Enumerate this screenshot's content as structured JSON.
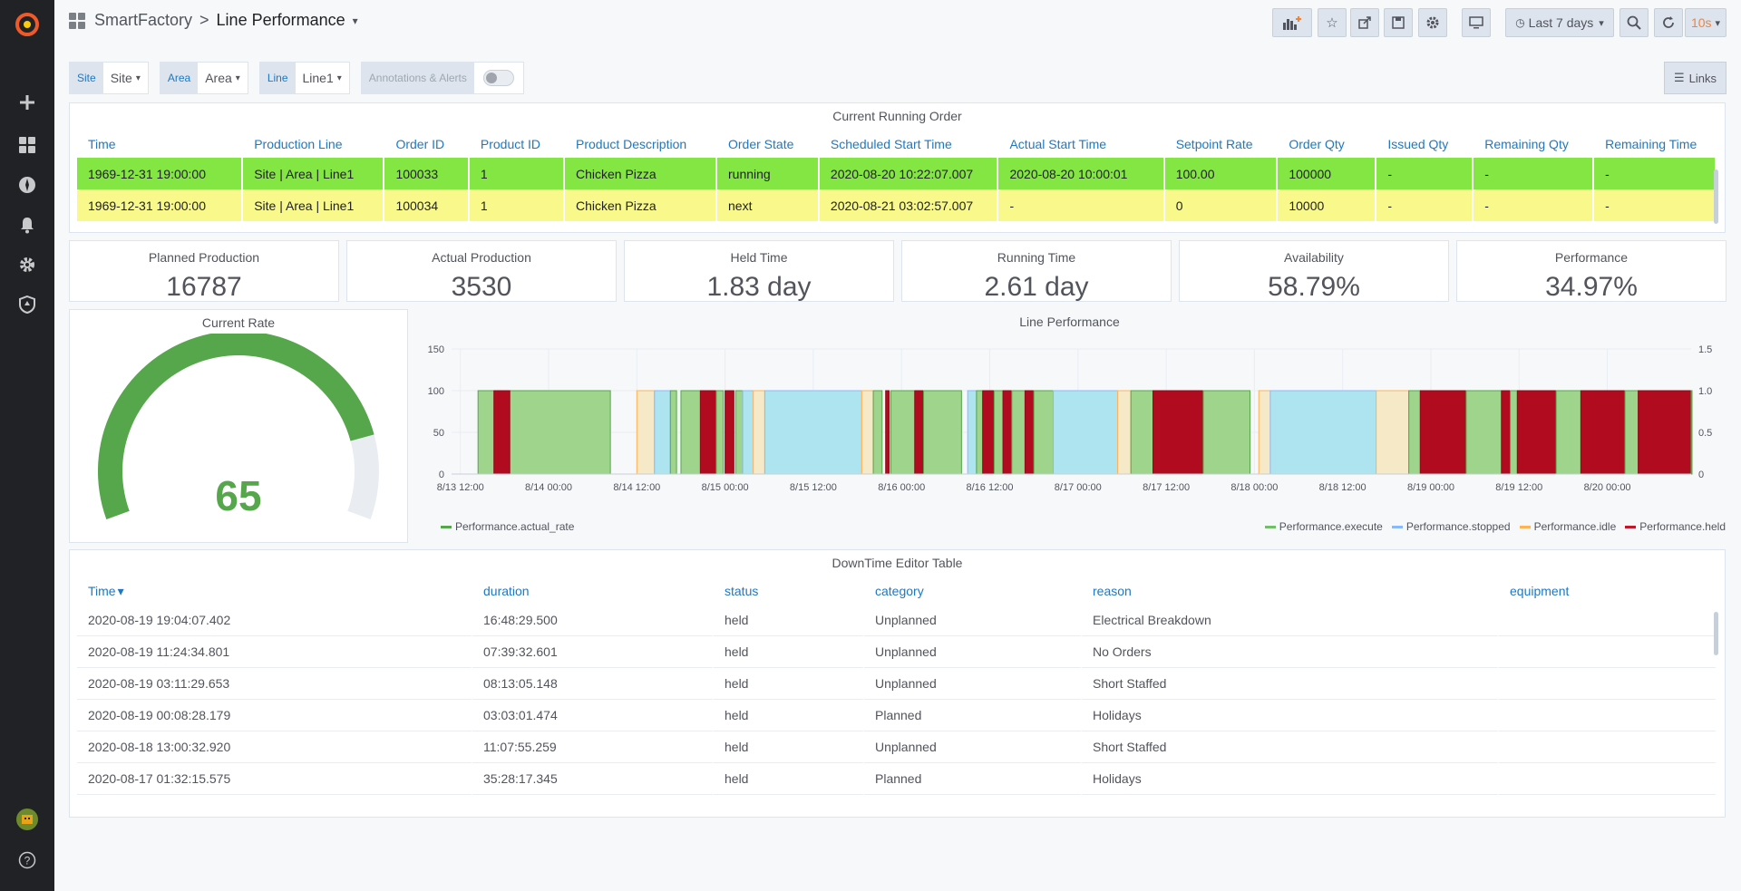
{
  "breadcrumb": {
    "folder": "SmartFactory",
    "separator": ">",
    "title": "Line Performance"
  },
  "toolbar": {
    "time_range": "Last 7 days",
    "refresh": "10s"
  },
  "variables": [
    {
      "label": "Site",
      "value": "Site"
    },
    {
      "label": "Area",
      "value": "Area"
    },
    {
      "label": "Line",
      "value": "Line1"
    }
  ],
  "annotations_label": "Annotations & Alerts",
  "links_label": "Links",
  "order_table": {
    "title": "Current Running Order",
    "headers": [
      "Time",
      "Production Line",
      "Order ID",
      "Product ID",
      "Product Description",
      "Order State",
      "Scheduled Start Time",
      "Actual Start Time",
      "Setpoint Rate",
      "Order Qty",
      "Issued Qty",
      "Remaining Qty",
      "Remaining Time"
    ],
    "rows": [
      [
        "1969-12-31 19:00:00",
        "Site | Area | Line1",
        "100033",
        "1",
        "Chicken Pizza",
        "running",
        "2020-08-20 10:22:07.007",
        "2020-08-20 10:00:01",
        "100.00",
        "100000",
        "-",
        "-",
        "-"
      ],
      [
        "1969-12-31 19:00:00",
        "Site | Area | Line1",
        "100034",
        "1",
        "Chicken Pizza",
        "next",
        "2020-08-21 03:02:57.007",
        "-",
        "0",
        "10000",
        "-",
        "-",
        "-"
      ]
    ],
    "row_colors": [
      "#84e643",
      "#f9f88a"
    ]
  },
  "stats": [
    {
      "label": "Planned Production",
      "value": "16787"
    },
    {
      "label": "Actual Production",
      "value": "3530"
    },
    {
      "label": "Held Time",
      "value": "1.83 day"
    },
    {
      "label": "Running Time",
      "value": "2.61 day"
    },
    {
      "label": "Availability",
      "value": "58.79%"
    },
    {
      "label": "Performance",
      "value": "34.97%"
    }
  ],
  "gauge": {
    "title": "Current Rate",
    "value": "65",
    "color": "#56a64b"
  },
  "chart_data": {
    "type": "area",
    "title": "Line Performance",
    "x_ticks": [
      "8/13 12:00",
      "8/14 00:00",
      "8/14 12:00",
      "8/15 00:00",
      "8/15 12:00",
      "8/16 00:00",
      "8/16 12:00",
      "8/17 00:00",
      "8/17 12:00",
      "8/18 00:00",
      "8/18 12:00",
      "8/19 00:00",
      "8/19 12:00",
      "8/20 00:00"
    ],
    "y_left": {
      "ticks": [
        "0",
        "50",
        "100",
        "150"
      ],
      "ylim": [
        0,
        150
      ]
    },
    "y_right": {
      "ticks": [
        "0",
        "0.5",
        "1.0",
        "1.5"
      ],
      "ylim": [
        0,
        1.5
      ]
    },
    "x_range": [
      -0.1,
      13.95
    ],
    "series_colors": {
      "execute": "#9ed48c",
      "stopped": "#aee3f0",
      "idle": "#f5e9c8",
      "held": "#b00b1e"
    },
    "legend_left": [
      {
        "name": "Performance.actual_rate",
        "color": "#56a64b"
      }
    ],
    "legend_right": [
      {
        "name": "Performance.execute",
        "color": "#73bf69"
      },
      {
        "name": "Performance.stopped",
        "color": "#8ab8ff"
      },
      {
        "name": "Performance.idle",
        "color": "#ffb357"
      },
      {
        "name": "Performance.held",
        "color": "#c4162a"
      }
    ],
    "segments": [
      {
        "s": "execute",
        "x0": 0.2,
        "x1": 1.7
      },
      {
        "s": "held",
        "x0": 0.38,
        "x1": 0.56
      },
      {
        "s": "idle",
        "x0": 2.0,
        "x1": 2.2
      },
      {
        "s": "stopped",
        "x0": 2.2,
        "x1": 2.38
      },
      {
        "s": "execute",
        "x0": 2.38,
        "x1": 2.45
      },
      {
        "s": "execute",
        "x0": 2.5,
        "x1": 2.72
      },
      {
        "s": "held",
        "x0": 2.72,
        "x1": 2.9
      },
      {
        "s": "execute",
        "x0": 2.9,
        "x1": 2.98
      },
      {
        "s": "held",
        "x0": 3.0,
        "x1": 3.1
      },
      {
        "s": "execute",
        "x0": 3.12,
        "x1": 3.2
      },
      {
        "s": "stopped",
        "x0": 3.2,
        "x1": 3.32
      },
      {
        "s": "idle",
        "x0": 3.32,
        "x1": 3.45
      },
      {
        "s": "stopped",
        "x0": 3.45,
        "x1": 4.55
      },
      {
        "s": "idle",
        "x0": 4.55,
        "x1": 4.68
      },
      {
        "s": "execute",
        "x0": 4.68,
        "x1": 4.78
      },
      {
        "s": "held",
        "x0": 4.82,
        "x1": 4.86
      },
      {
        "s": "execute",
        "x0": 4.88,
        "x1": 5.15
      },
      {
        "s": "held",
        "x0": 5.15,
        "x1": 5.25
      },
      {
        "s": "execute",
        "x0": 5.25,
        "x1": 5.68
      },
      {
        "s": "stopped",
        "x0": 5.75,
        "x1": 5.85
      },
      {
        "s": "execute",
        "x0": 5.85,
        "x1": 5.92
      },
      {
        "s": "held",
        "x0": 5.92,
        "x1": 6.05
      },
      {
        "s": "execute",
        "x0": 6.05,
        "x1": 6.15
      },
      {
        "s": "held",
        "x0": 6.15,
        "x1": 6.25
      },
      {
        "s": "execute",
        "x0": 6.25,
        "x1": 6.4
      },
      {
        "s": "held",
        "x0": 6.4,
        "x1": 6.5
      },
      {
        "s": "execute",
        "x0": 6.5,
        "x1": 6.72
      },
      {
        "s": "stopped",
        "x0": 6.72,
        "x1": 7.45
      },
      {
        "s": "idle",
        "x0": 7.45,
        "x1": 7.6
      },
      {
        "s": "execute",
        "x0": 7.6,
        "x1": 7.85
      },
      {
        "s": "held",
        "x0": 7.85,
        "x1": 8.42
      },
      {
        "s": "execute",
        "x0": 8.42,
        "x1": 8.95
      },
      {
        "s": "idle",
        "x0": 9.05,
        "x1": 9.18
      },
      {
        "s": "stopped",
        "x0": 9.18,
        "x1": 10.38
      },
      {
        "s": "idle",
        "x0": 10.38,
        "x1": 10.75
      },
      {
        "s": "execute",
        "x0": 10.75,
        "x1": 10.88
      },
      {
        "s": "held",
        "x0": 10.88,
        "x1": 11.4
      },
      {
        "s": "execute",
        "x0": 11.4,
        "x1": 11.8
      },
      {
        "s": "held",
        "x0": 11.8,
        "x1": 11.9
      },
      {
        "s": "execute",
        "x0": 11.9,
        "x1": 11.98
      },
      {
        "s": "held",
        "x0": 11.98,
        "x1": 12.42
      },
      {
        "s": "execute",
        "x0": 12.42,
        "x1": 12.7
      },
      {
        "s": "held",
        "x0": 12.7,
        "x1": 13.2
      },
      {
        "s": "execute",
        "x0": 13.2,
        "x1": 13.35
      },
      {
        "s": "held",
        "x0": 13.35,
        "x1": 13.95
      },
      {
        "s": "execute",
        "x0": 13.95,
        "x1": 14.0
      }
    ]
  },
  "downtime_table": {
    "title": "DownTime Editor Table",
    "headers": [
      "Time",
      "duration",
      "status",
      "category",
      "reason",
      "equipment"
    ],
    "sort_indicator": "▾",
    "rows": [
      [
        "2020-08-19 19:04:07.402",
        "16:48:29.500",
        "held",
        "Unplanned",
        "Electrical Breakdown",
        ""
      ],
      [
        "2020-08-19 11:24:34.801",
        "07:39:32.601",
        "held",
        "Unplanned",
        "No Orders",
        ""
      ],
      [
        "2020-08-19 03:11:29.653",
        "08:13:05.148",
        "held",
        "Unplanned",
        "Short Staffed",
        ""
      ],
      [
        "2020-08-19 00:08:28.179",
        "03:03:01.474",
        "held",
        "Planned",
        "Holidays",
        ""
      ],
      [
        "2020-08-18 13:00:32.920",
        "11:07:55.259",
        "held",
        "Unplanned",
        "Short Staffed",
        ""
      ],
      [
        "2020-08-17 01:32:15.575",
        "35:28:17.345",
        "held",
        "Planned",
        "Holidays",
        ""
      ]
    ]
  }
}
